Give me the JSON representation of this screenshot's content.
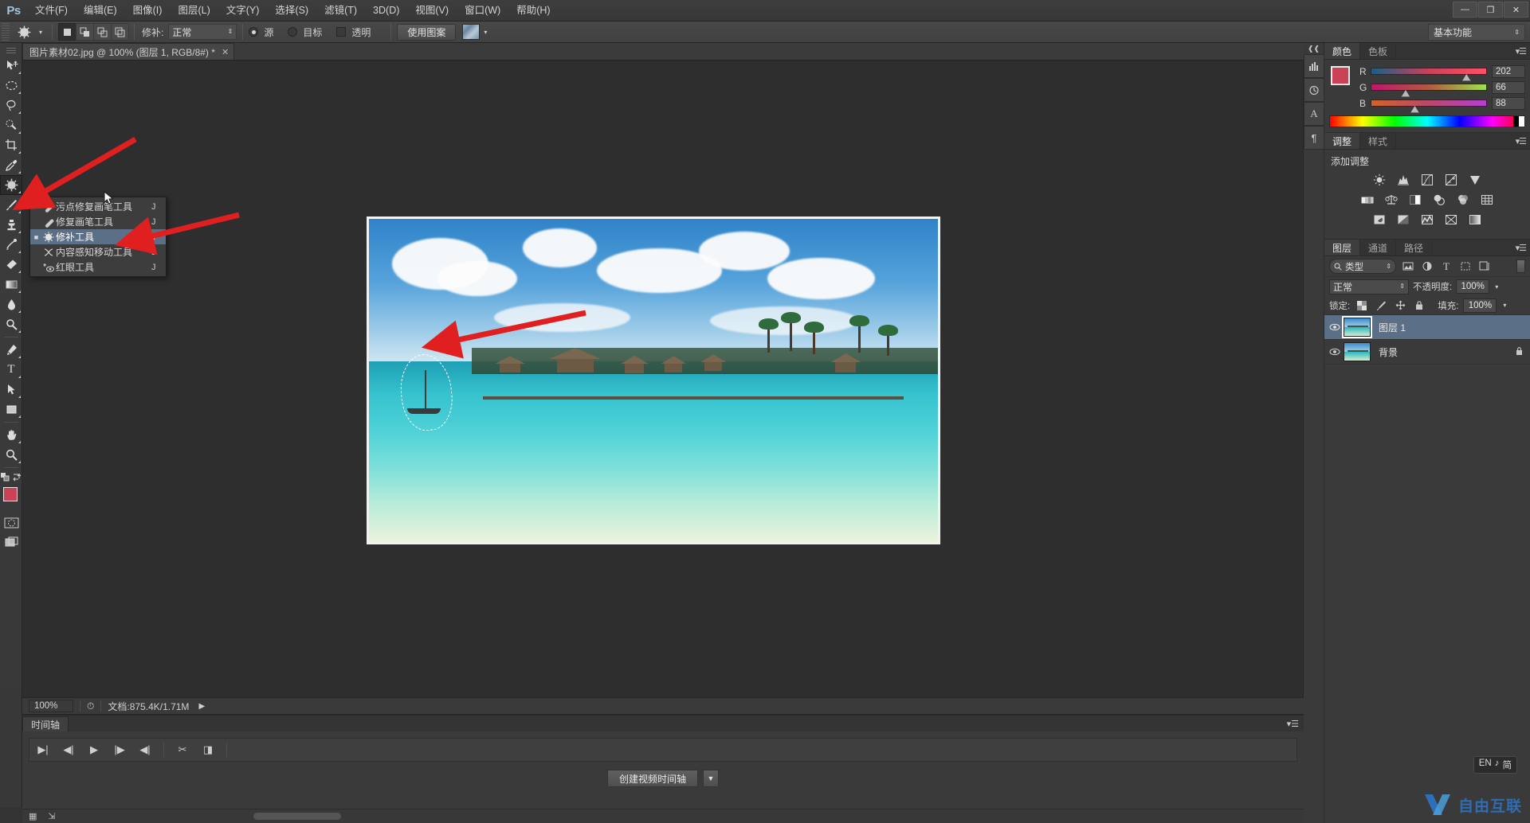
{
  "app": {
    "logo": "Ps",
    "workspace": "基本功能"
  },
  "menubar": {
    "items": [
      {
        "label": "文件(F)"
      },
      {
        "label": "编辑(E)"
      },
      {
        "label": "图像(I)"
      },
      {
        "label": "图层(L)"
      },
      {
        "label": "文字(Y)"
      },
      {
        "label": "选择(S)"
      },
      {
        "label": "滤镜(T)"
      },
      {
        "label": "3D(D)"
      },
      {
        "label": "视图(V)"
      },
      {
        "label": "窗口(W)"
      },
      {
        "label": "帮助(H)"
      }
    ],
    "window_buttons": {
      "minimize": "—",
      "restore": "❐",
      "close": "✕"
    }
  },
  "optionsbar": {
    "tool_icon": "patch-tool-icon",
    "selection_modes": [
      "new-selection",
      "add-to-selection",
      "subtract-from-selection",
      "intersect-selection"
    ],
    "patch_label": "修补:",
    "patch_mode": "正常",
    "source_label": "源",
    "destination_label": "目标",
    "transparent_label": "透明",
    "use_pattern_label": "使用图案"
  },
  "document": {
    "tab_title": "图片素材02.jpg @ 100% (图层 1, RGB/8#) *",
    "close": "✕"
  },
  "toolbar": {
    "tools": [
      {
        "name": "move-tool",
        "glyph": "move"
      },
      {
        "name": "marquee-tool",
        "glyph": "marquee"
      },
      {
        "name": "lasso-tool",
        "glyph": "lasso"
      },
      {
        "name": "quick-selection-tool",
        "glyph": "quickselect"
      },
      {
        "name": "crop-tool",
        "glyph": "crop"
      },
      {
        "name": "eyedropper-tool",
        "glyph": "eyedropper"
      },
      {
        "name": "patch-tool",
        "glyph": "patch",
        "selected": true
      },
      {
        "name": "brush-tool",
        "glyph": "brush"
      },
      {
        "name": "clone-stamp-tool",
        "glyph": "stamp"
      },
      {
        "name": "history-brush-tool",
        "glyph": "historybrush"
      },
      {
        "name": "eraser-tool",
        "glyph": "eraser"
      },
      {
        "name": "gradient-tool",
        "glyph": "gradient"
      },
      {
        "name": "blur-tool",
        "glyph": "blur"
      },
      {
        "name": "dodge-tool",
        "glyph": "dodge"
      },
      {
        "name": "pen-tool",
        "glyph": "pen"
      },
      {
        "name": "type-tool",
        "glyph": "T"
      },
      {
        "name": "path-selection-tool",
        "glyph": "pathselect"
      },
      {
        "name": "rectangle-tool",
        "glyph": "rectangle"
      },
      {
        "name": "hand-tool",
        "glyph": "hand"
      },
      {
        "name": "zoom-tool",
        "glyph": "zoom"
      }
    ],
    "foreground_color": "#ca4258",
    "background_color": "#ffffff"
  },
  "flyout": {
    "items": [
      {
        "label": "污点修复画笔工具",
        "key": "J",
        "selected": false
      },
      {
        "label": "修复画笔工具",
        "key": "J",
        "selected": false
      },
      {
        "label": "修补工具",
        "key": "J",
        "selected": true
      },
      {
        "label": "内容感知移动工具",
        "key": "J",
        "selected": false
      },
      {
        "label": "红眼工具",
        "key": "J",
        "selected": false
      }
    ]
  },
  "statusbar": {
    "zoom": "100%",
    "doc_info": "文档:875.4K/1.71M",
    "arrow": "▶"
  },
  "timeline": {
    "tab": "时间轴",
    "controls": [
      "▶|",
      "◀|",
      "▶",
      "|▶",
      "◀|"
    ],
    "tools": [
      "✂",
      "◨"
    ],
    "create_button": "创建视频时间轴",
    "create_caret": "▼"
  },
  "panels": {
    "color": {
      "tabs": [
        {
          "label": "颜色",
          "active": true
        },
        {
          "label": "色板",
          "active": false
        }
      ],
      "channels": [
        {
          "label": "R",
          "value": "202",
          "pos": 79
        },
        {
          "label": "G",
          "value": "66",
          "pos": 26
        },
        {
          "label": "B",
          "value": "88",
          "pos": 34
        }
      ],
      "foreground": "#ca4258",
      "background": "#ffffff"
    },
    "adjustments": {
      "tabs": [
        {
          "label": "调整",
          "active": true
        },
        {
          "label": "样式",
          "active": false
        }
      ],
      "title": "添加调整",
      "rows": [
        [
          "brightness-contrast-icon",
          "levels-icon",
          "curves-icon",
          "exposure-icon",
          "vibrance-icon"
        ],
        [
          "hue-saturation-icon",
          "color-balance-icon",
          "black-white-icon",
          "photo-filter-icon",
          "channel-mixer-icon",
          "color-lookup-icon"
        ],
        [
          "invert-icon",
          "posterize-icon",
          "threshold-icon",
          "selective-color-icon",
          "gradient-map-icon"
        ]
      ]
    },
    "layers": {
      "tabs": [
        {
          "label": "图层",
          "active": true
        },
        {
          "label": "通道",
          "active": false
        },
        {
          "label": "路径",
          "active": false
        }
      ],
      "filter_label": "类型",
      "filter_icons": [
        "pixel-filter-icon",
        "adjustment-filter-icon",
        "type-filter-icon",
        "shape-filter-icon",
        "smartobject-filter-icon"
      ],
      "blend_mode": "正常",
      "opacity_label": "不透明度:",
      "opacity_value": "100%",
      "lock_label": "锁定:",
      "lock_icons": [
        "lock-transparent-icon",
        "lock-image-icon",
        "lock-position-icon",
        "lock-all-icon"
      ],
      "fill_label": "填充:",
      "fill_value": "100%",
      "items": [
        {
          "name": "图层 1",
          "selected": true,
          "locked": false
        },
        {
          "name": "背景",
          "selected": false,
          "locked": true
        }
      ]
    }
  },
  "ime": {
    "lang": "EN",
    "mode": "简",
    "icon": "♪"
  },
  "watermark": {
    "text": "自由互联"
  },
  "annotations": {
    "arrow_color": "#e02020",
    "count": 3
  }
}
